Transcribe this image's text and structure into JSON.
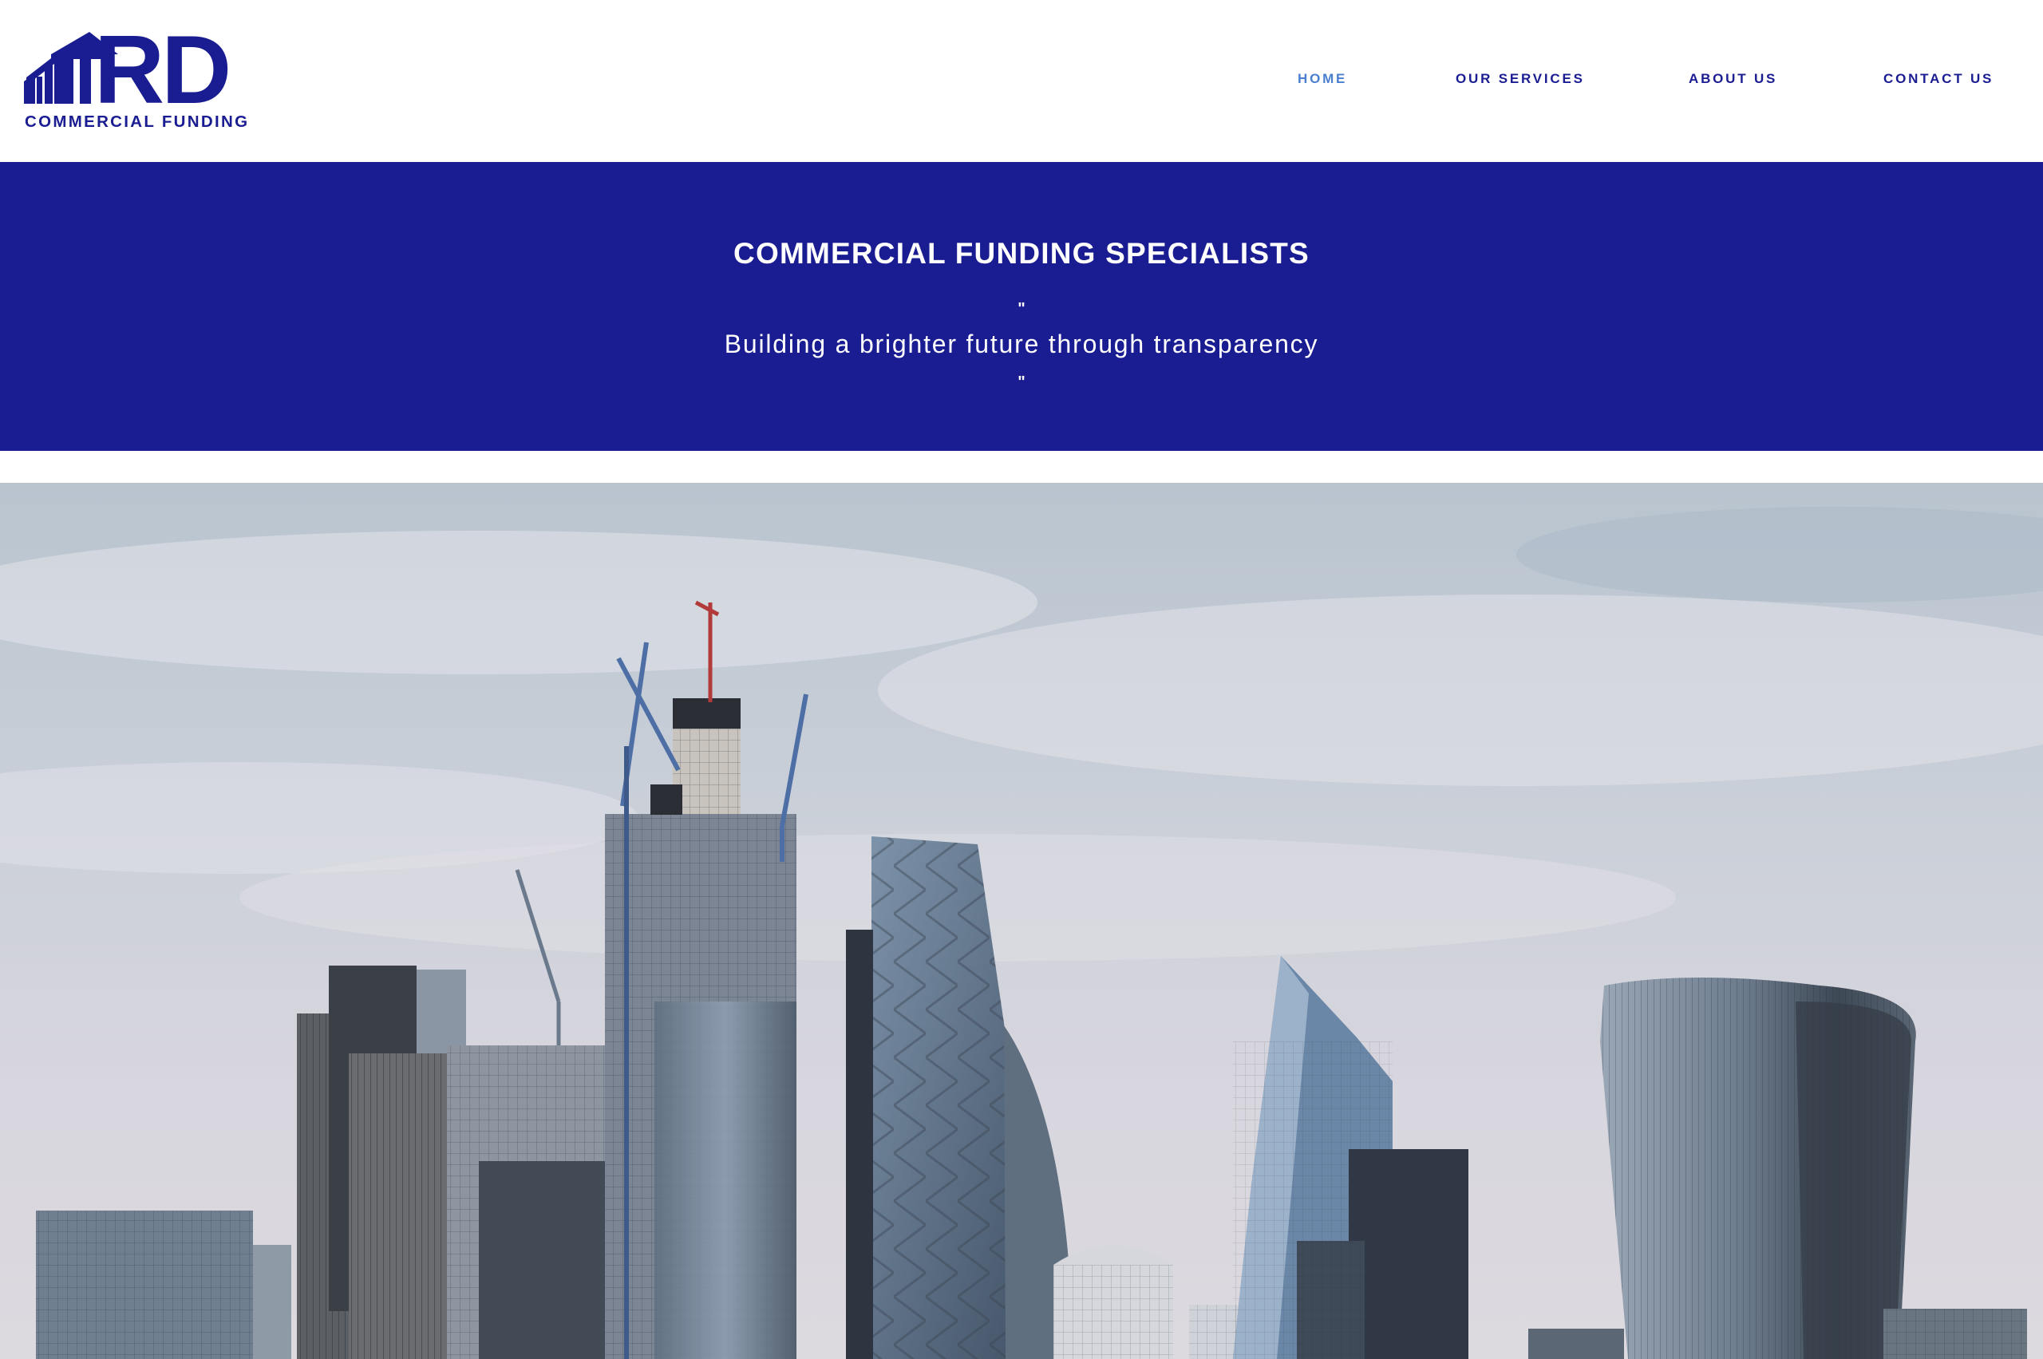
{
  "brand": {
    "logo_letters": "RD",
    "logo_subtitle": "COMMERCIAL FUNDING",
    "logo_icon": "rising-bars-house-icon"
  },
  "nav": {
    "items": [
      {
        "label": "HOME",
        "active": true
      },
      {
        "label": "OUR SERVICES",
        "active": false
      },
      {
        "label": "ABOUT US",
        "active": false
      },
      {
        "label": "CONTACT US",
        "active": false
      }
    ]
  },
  "banner": {
    "title": "COMMERCIAL FUNDING SPECIALISTS",
    "quote_open": "\"",
    "tagline": "Building a brighter future through transparency",
    "quote_close": "\""
  },
  "hero": {
    "subject": "city-skyline-photo"
  },
  "colors": {
    "brand_navy": "#1a1c92",
    "nav_active": "#4a7fd0",
    "header_bg": "#ffffff"
  }
}
